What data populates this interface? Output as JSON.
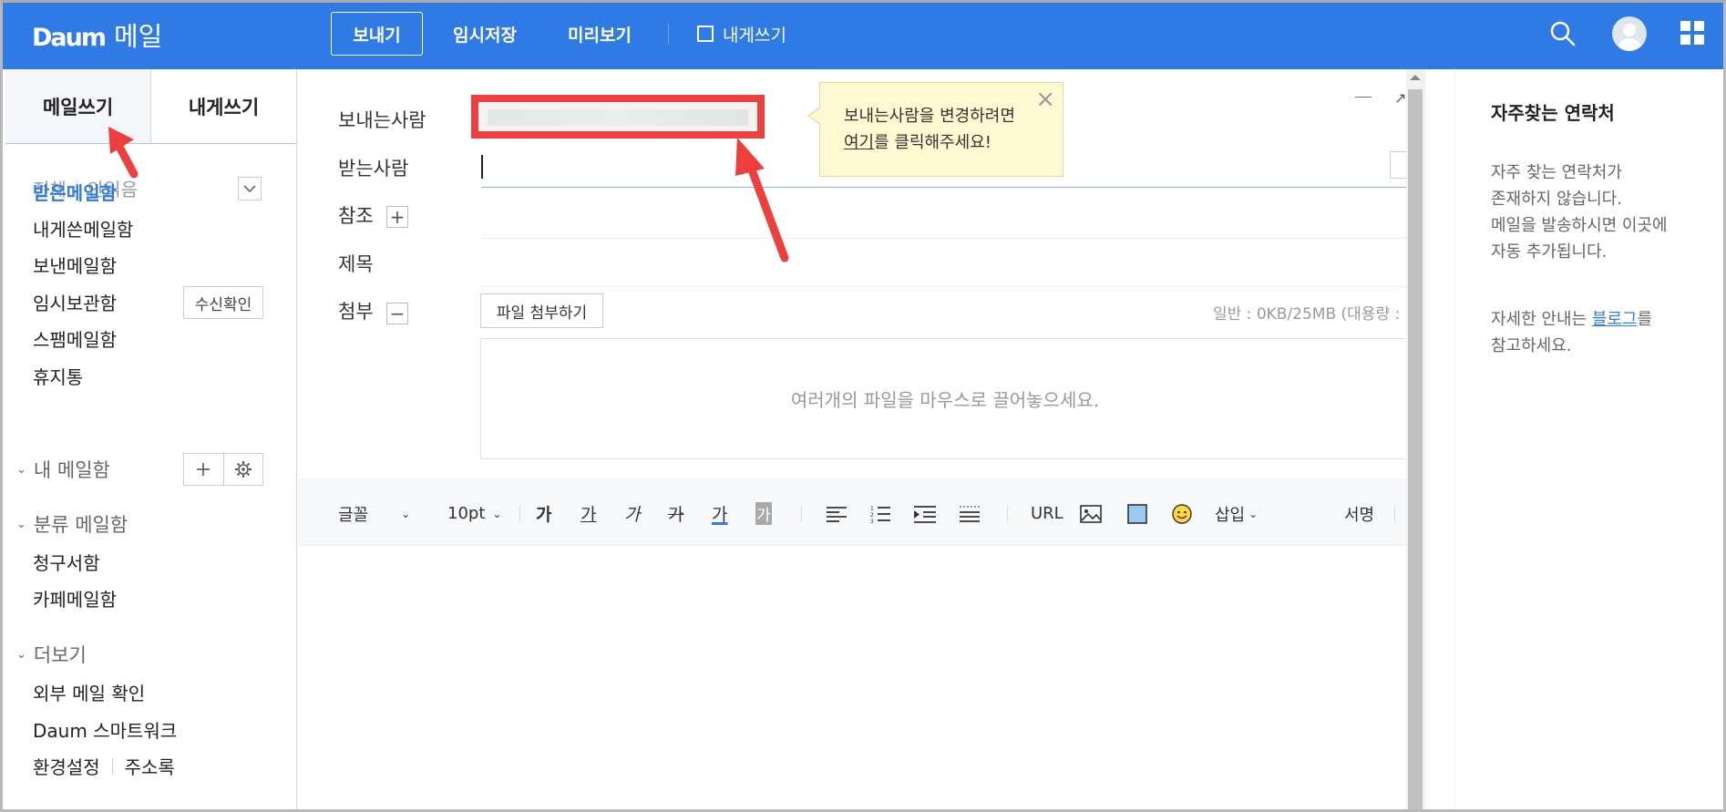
{
  "header": {
    "brand": "Daum",
    "service": "메일",
    "send": "보내기",
    "temp_save": "임시저장",
    "preview": "미리보기",
    "write_to_self": "내게쓰기"
  },
  "sidebar": {
    "tabs": [
      "메일쓰기",
      "내게쓰기"
    ],
    "filter": {
      "all": "전체",
      "unread": "안읽음"
    },
    "mailboxes": [
      "받은메일함",
      "내게쓴메일함",
      "보낸메일함",
      "임시보관함",
      "스팸메일함",
      "휴지통"
    ],
    "receipt_check": "수신확인",
    "my_mailbox": "내 메일함",
    "category_mailbox": "분류 메일함",
    "category_items": [
      "청구서함",
      "카페메일함"
    ],
    "more": "더보기",
    "more_items": [
      "외부 메일 확인",
      "Daum 스마트워크"
    ],
    "settings": "환경설정",
    "address_book": "주소록"
  },
  "compose": {
    "sender_label": "보내는사람",
    "recipient_label": "받는사람",
    "cc_label": "참조",
    "subject_label": "제목",
    "attachment_label": "첨부",
    "attach_button": "파일 첨부하기",
    "quota": "일반 : 0KB/25MB (대용량 :",
    "dropzone_text": "여러개의 파일을 마우스로 끌어놓으세요."
  },
  "tooltip": {
    "line1": "보내는사람을 변경하려면",
    "link": "여기",
    "line2_rest": "를 클릭해주세요!"
  },
  "toolbar": {
    "font": "글꼴",
    "size": "10pt",
    "bold": "가",
    "underline": "가",
    "italic": "가",
    "strike": "가",
    "font_color": "가",
    "bg_color": "가",
    "url": "URL",
    "insert": "삽입",
    "signature": "서명"
  },
  "right_panel": {
    "title": "자주찾는 연락처",
    "desc": [
      "자주 찾는 연락처가",
      "존재하지 않습니다.",
      "메일을 발송하시면 이곳에",
      "자동 추가됩니다."
    ],
    "guide_prefix": "자세한 안내는 ",
    "guide_link": "블로그",
    "guide_suffix": "를",
    "guide_line2": "참고하세요."
  },
  "colors": {
    "brand_blue": "#2f7ae5",
    "annotation_red": "#ee3f3f",
    "tooltip_bg": "#fff9d1"
  }
}
